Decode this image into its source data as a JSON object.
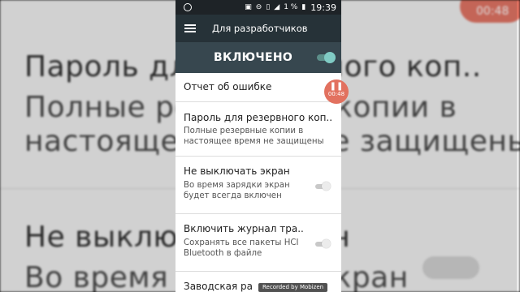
{
  "background": {
    "line1": "Пароль для резервного коп..",
    "line2": "Полные резервные копии в",
    "line3": "настоящее время не защищены",
    "line4": "Не выключать экран",
    "line5": "Во время зарядки экран"
  },
  "status_bar": {
    "battery": "1 %",
    "time": "19:39"
  },
  "toolbar": {
    "title": "Для разработчиков"
  },
  "master_switch": {
    "label": "ВКЛЮЧЕНО",
    "on": true
  },
  "settings": [
    {
      "title": "Отчет об ошибке"
    },
    {
      "title": "Пароль для резервного коп..",
      "summary": "Полные резервные копии в настоящее время не защищены"
    },
    {
      "title": "Не выключать экран",
      "summary": "Во время зарядки экран будет всегда включен",
      "toggle": false
    },
    {
      "title": "Включить журнал тра..",
      "summary": "Сохранять все пакеты HCI Bluetooth в файле",
      "toggle": false
    },
    {
      "title": "Заводская ра"
    }
  ],
  "recorder": {
    "time": "00:48",
    "watermark": "Recorded by Mobizen"
  },
  "colors": {
    "toolbar": "#263238",
    "master_bar": "#37474f",
    "accent": "#80cbc4"
  }
}
